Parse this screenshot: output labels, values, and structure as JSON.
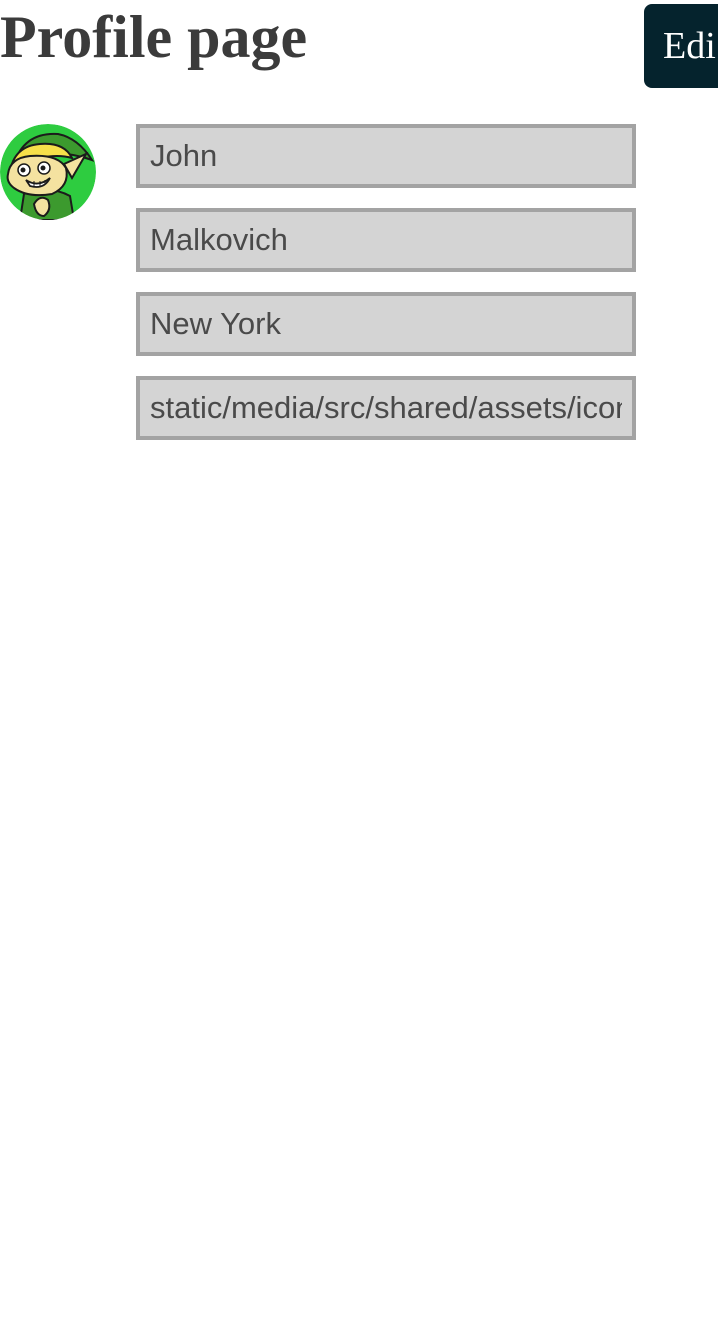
{
  "header": {
    "title": "Profile page",
    "edit_label": "Edi"
  },
  "profile": {
    "avatar_icon": "cartoon-elf-avatar-icon",
    "fields": {
      "first_name": "John",
      "last_name": "Malkovich",
      "city": "New York",
      "avatar_path": "static/media/src/shared/assets/icons/avatar.png"
    }
  },
  "colors": {
    "title": "#3b3b3b",
    "button_bg": "#05232d",
    "button_text": "#ffffff",
    "field_bg": "#d4d4d4",
    "field_border": "#a3a3a3",
    "avatar_ring": "#2ecc40"
  }
}
